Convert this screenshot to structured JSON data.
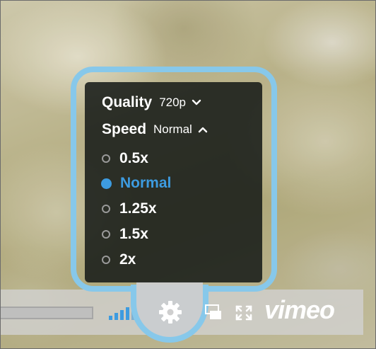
{
  "player": {
    "logo_text": "vimeo",
    "accent_color": "#3d9be0",
    "highlight_color": "#87c8ea"
  },
  "settings_menu": {
    "quality": {
      "label": "Quality",
      "value": "720p",
      "icon": "chevron-down-icon"
    },
    "speed": {
      "label": "Speed",
      "value": "Normal",
      "icon": "chevron-up-icon"
    },
    "speed_options": [
      {
        "label": "0.5x",
        "selected": false
      },
      {
        "label": "Normal",
        "selected": true
      },
      {
        "label": "1.25x",
        "selected": false
      },
      {
        "label": "1.5x",
        "selected": false
      },
      {
        "label": "2x",
        "selected": false
      }
    ]
  },
  "controls": {
    "icons": [
      "volume-icon",
      "settings-gear-icon",
      "picture-in-picture-icon",
      "fullscreen-icon"
    ]
  }
}
